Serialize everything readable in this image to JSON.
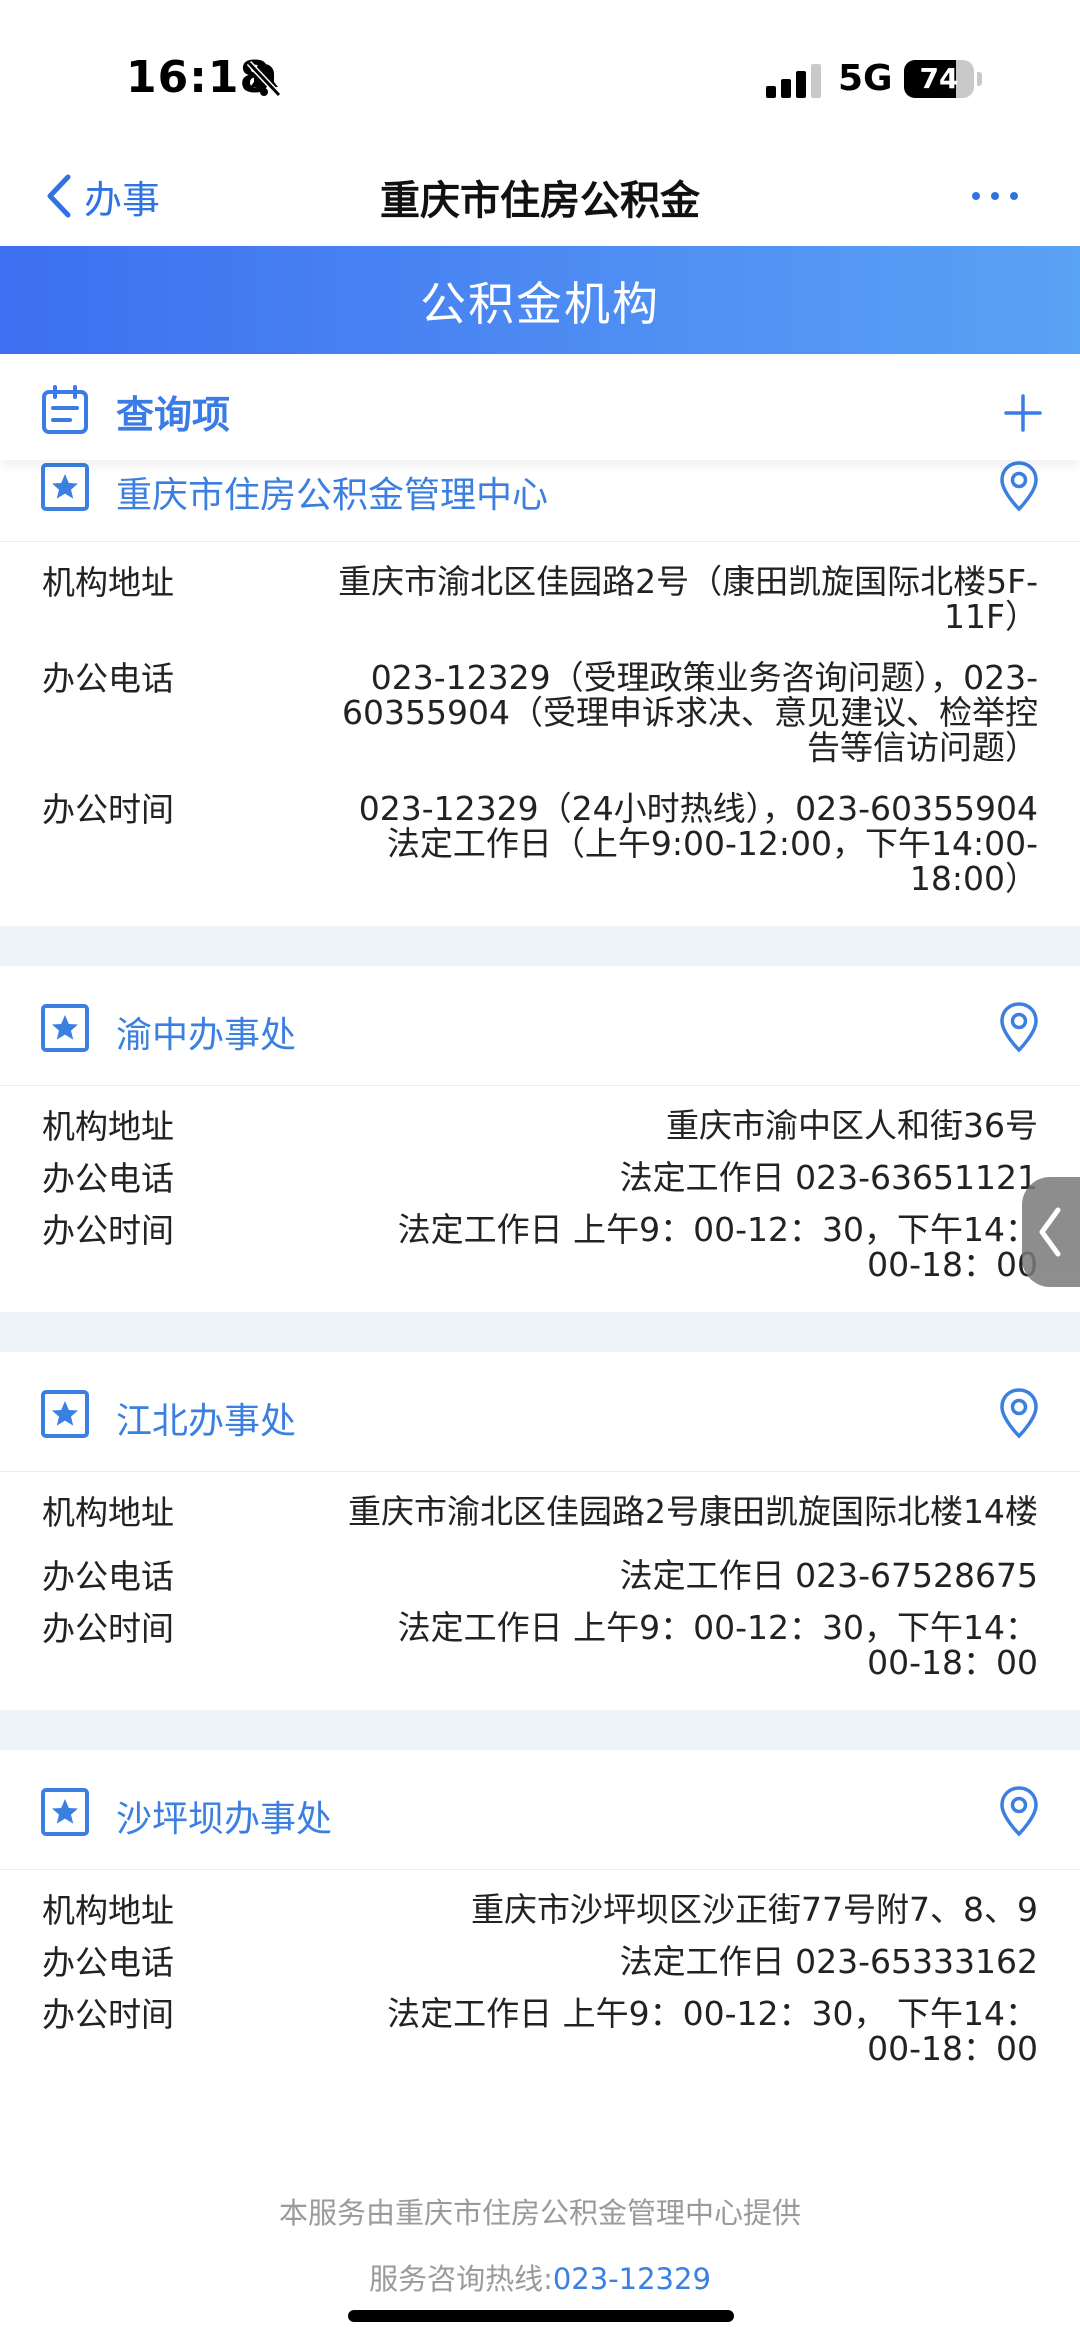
{
  "status_bar": {
    "time": "16:18",
    "network": "5G",
    "battery": "74",
    "battery_level": 0.74
  },
  "nav": {
    "back_label": "办事",
    "title": "重庆市住房公积金"
  },
  "banner": {
    "title": "公积金机构"
  },
  "query": {
    "label": "查询项"
  },
  "offices": [
    {
      "name": "重庆市住房公积金管理中心",
      "address_label": "机构地址",
      "address": "重庆市渝北区佳园路2号（康田凯旋国际北楼5F-11F）",
      "phone_label": "办公电话",
      "phone": "023-12329（受理政策业务咨询问题），023-60355904（受理申诉求决、意见建议、检举控告等信访问题）",
      "hours_label": "办公时间",
      "hours": "023-12329（24小时热线），023-60355904 法定工作日（上午9:00-12:00，下午14:00-18:00）"
    },
    {
      "name": "渝中办事处",
      "address_label": "机构地址",
      "address": "重庆市渝中区人和街36号",
      "phone_label": "办公电话",
      "phone": "法定工作日 023-63651121",
      "hours_label": "办公时间",
      "hours": "法定工作日 上午9：00-12：30，下午14：00-18：00"
    },
    {
      "name": "江北办事处",
      "address_label": "机构地址",
      "address": "重庆市渝北区佳园路2号康田凯旋国际北楼14楼",
      "phone_label": "办公电话",
      "phone": "法定工作日 023-67528675",
      "hours_label": "办公时间",
      "hours": "法定工作日 上午9：00-12：30，下午14：00-18：00"
    },
    {
      "name": "沙坪坝办事处",
      "address_label": "机构地址",
      "address": "重庆市沙坪坝区沙正街77号附7、8、9",
      "phone_label": "办公电话",
      "phone": "法定工作日 023-65333162",
      "hours_label": "办公时间",
      "hours": "法定工作日 上午9：00-12：30， 下午14：00-18：00"
    }
  ],
  "footer": {
    "provider": "本服务由重庆市住房公积金管理中心提供",
    "hotline_prefix": "服务咨询热线:",
    "hotline": "023-12329"
  },
  "icons": {
    "back": "chevron-left-icon",
    "more": "more-dots-icon",
    "query": "clipboard-list-icon",
    "add": "plus-icon",
    "star": "star-badge-icon",
    "location": "map-pin-icon",
    "side_handle": "chevron-left-icon"
  },
  "colors": {
    "accent": "#3b7fe0",
    "banner_start": "#3d6ff0",
    "banner_end": "#5aa2f4",
    "section_gap": "#eef2f9"
  }
}
